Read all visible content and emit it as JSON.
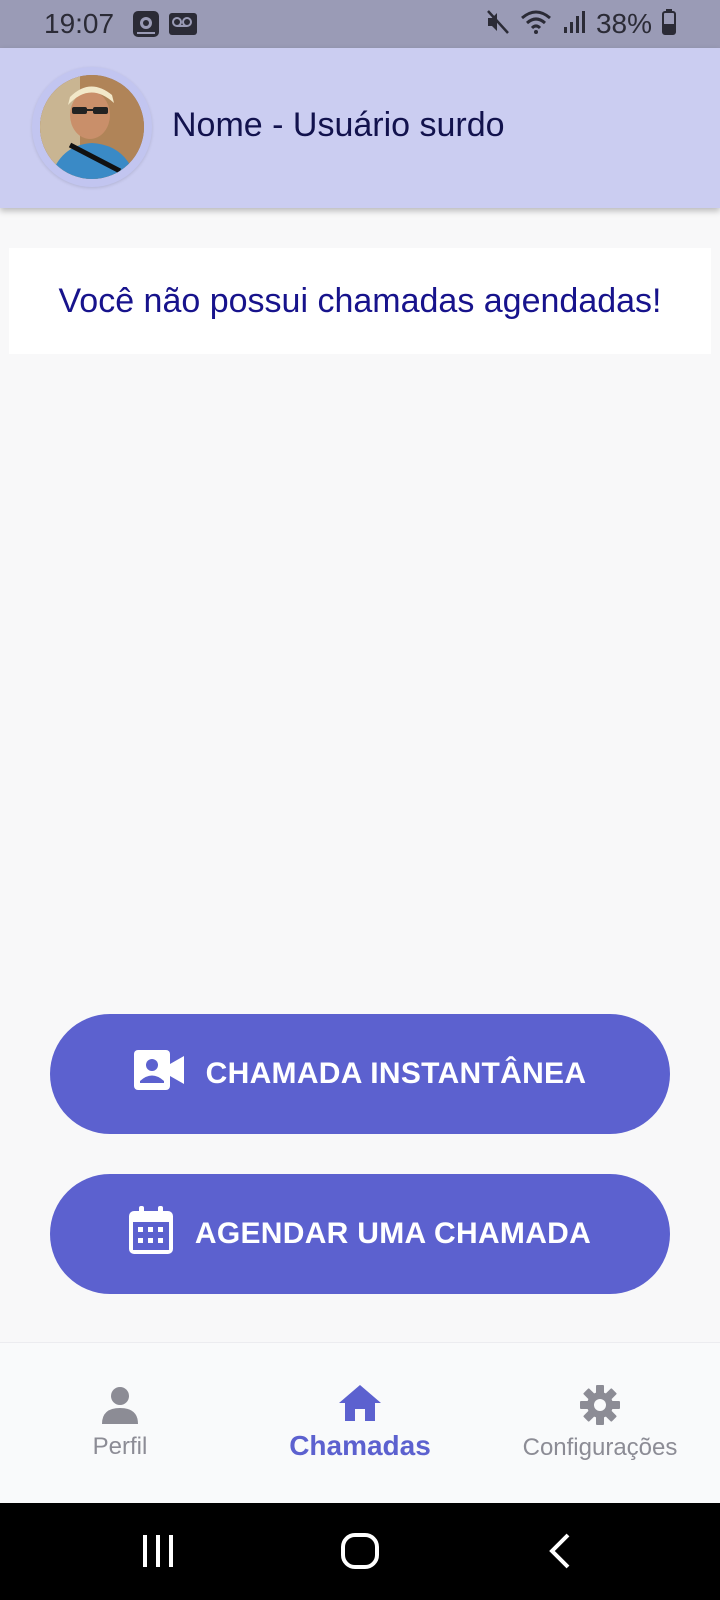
{
  "status_bar": {
    "time": "19:07",
    "battery": "38%",
    "icons": [
      "gallery-icon",
      "voicemail-icon",
      "mute-icon",
      "wifi-icon",
      "signal-icon",
      "battery-icon"
    ]
  },
  "header": {
    "user_name": "Nome - Usuário surdo"
  },
  "main": {
    "empty_message": "Você não possui chamadas agendadas!"
  },
  "actions": {
    "instant_call": {
      "label": "CHAMADA INSTANTÂNEA",
      "icon": "video-contact-icon"
    },
    "schedule_call": {
      "label": "AGENDAR UMA CHAMADA",
      "icon": "calendar-icon"
    }
  },
  "bottom_nav": {
    "items": [
      {
        "label": "Perfil",
        "icon": "person-icon",
        "active": false
      },
      {
        "label": "Chamadas",
        "icon": "home-icon",
        "active": true
      },
      {
        "label": "Configurações",
        "icon": "gear-icon",
        "active": false
      }
    ]
  },
  "colors": {
    "primary": "#5c61cf",
    "header_bg": "#cbcdf1",
    "status_bar_bg": "#9a9bb6",
    "text_dark": "#12124d",
    "message_text": "#17138c",
    "nav_inactive": "#8c8c95"
  }
}
